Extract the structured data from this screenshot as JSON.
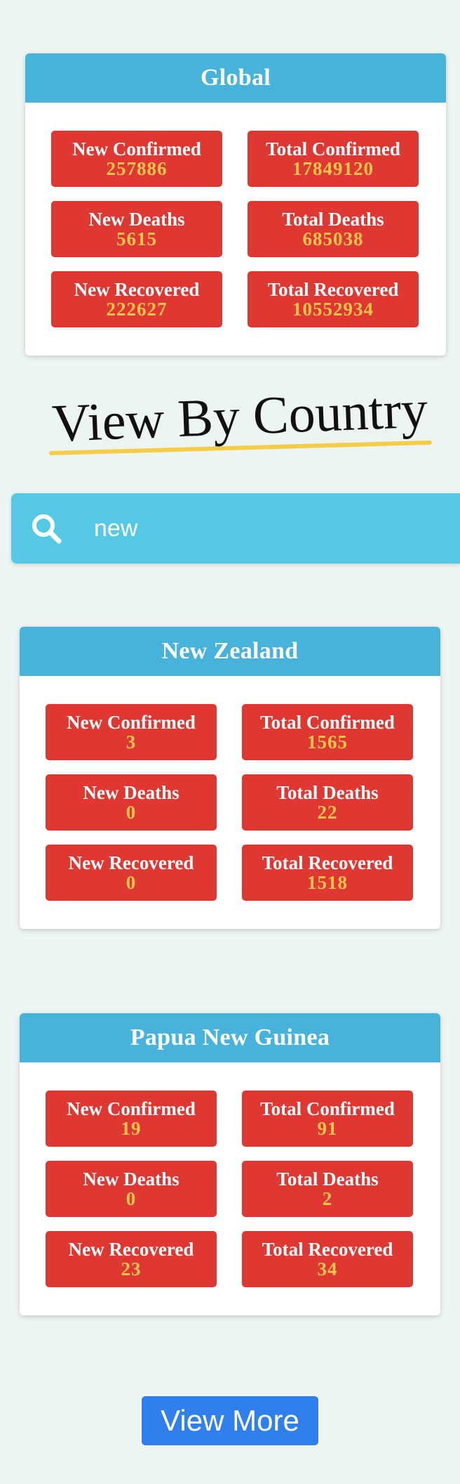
{
  "global": {
    "title": "Global",
    "stats": [
      {
        "label": "New Confirmed",
        "value": "257886"
      },
      {
        "label": "Total Confirmed",
        "value": "17849120"
      },
      {
        "label": "New Deaths",
        "value": "5615"
      },
      {
        "label": "Total Deaths",
        "value": "685038"
      },
      {
        "label": "New Recovered",
        "value": "222627"
      },
      {
        "label": "Total Recovered",
        "value": "10552934"
      }
    ]
  },
  "section_title": "View By Country",
  "search": {
    "value": "new",
    "icon": "search-icon"
  },
  "countries": [
    {
      "name": "New Zealand",
      "stats": [
        {
          "label": "New Confirmed",
          "value": "3"
        },
        {
          "label": "Total Confirmed",
          "value": "1565"
        },
        {
          "label": "New Deaths",
          "value": "0"
        },
        {
          "label": "Total Deaths",
          "value": "22"
        },
        {
          "label": "New Recovered",
          "value": "0"
        },
        {
          "label": "Total Recovered",
          "value": "1518"
        }
      ]
    },
    {
      "name": "Papua New Guinea",
      "stats": [
        {
          "label": "New Confirmed",
          "value": "19"
        },
        {
          "label": "Total Confirmed",
          "value": "91"
        },
        {
          "label": "New Deaths",
          "value": "0"
        },
        {
          "label": "Total Deaths",
          "value": "2"
        },
        {
          "label": "New Recovered",
          "value": "23"
        },
        {
          "label": "Total Recovered",
          "value": "34"
        }
      ]
    }
  ],
  "view_more_label": "View More",
  "colors": {
    "header": "#48b3da",
    "stat_background": "#df3832",
    "stat_value": "#f7c64a",
    "search_background": "#55c8e4",
    "button": "#2f80ec",
    "page_background": "#edf5f3",
    "title_underline": "#f5cc46"
  }
}
